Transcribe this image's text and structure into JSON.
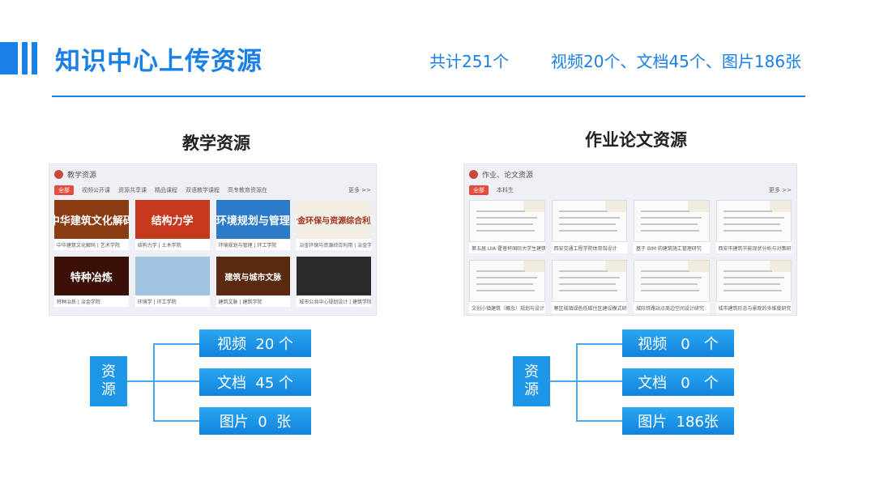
{
  "header": {
    "title": "知识中心上传资源",
    "total": "共计251个",
    "breakdown": "视频20个、文档45个、图片186张"
  },
  "teaching": {
    "title": "教学资源",
    "panel": {
      "name": "教学资源",
      "tabs": [
        "全部",
        "视频公开课",
        "资源共享课",
        "精品课程",
        "双语教学课程",
        "高专教育资源在"
      ],
      "more": "更多 >>",
      "cards": [
        {
          "thumb": "中华建筑文化解码",
          "caption": "中华建筑文化解码 | 艺术学院",
          "color": "#8a3b12"
        },
        {
          "thumb": "结构力学",
          "caption": "结构力学 | 土木学院",
          "color": "#c53a1e"
        },
        {
          "thumb": "环境规划与管理",
          "caption": "环境规划与管理 | 环工学院",
          "color": "#2c7bc9"
        },
        {
          "thumb": "冶金环保与资源综合利用",
          "caption": "冶金环保与资源综合利用 | 冶金学院",
          "color": "#f4efe3"
        },
        {
          "thumb": "特种冶炼",
          "caption": "特种冶炼 | 冶金学院",
          "color": "#3a1008"
        },
        {
          "thumb": "",
          "caption": "环境学 | 环工学院",
          "color": "#9fc3e0"
        },
        {
          "thumb": "建筑与城市文脉",
          "caption": "建筑文脉 | 建筑学院",
          "color": "#5a2a10"
        },
        {
          "thumb": "",
          "caption": "城市公共中心规划设计 | 建筑学院",
          "color": "#2a2a2a"
        }
      ]
    },
    "resource_label": [
      "资",
      "源"
    ],
    "leaves": [
      "视频  20 个",
      "文档  45 个",
      "图片  0  张"
    ]
  },
  "homework": {
    "title": "作业论文资源",
    "panel": {
      "name": "作业、论文资源",
      "tabs": [
        "全部",
        "本科生"
      ],
      "more": "更多 >>",
      "cards": [
        {
          "caption": "第五届 UIA 霍普杯国际大学生建筑设计竞赛"
        },
        {
          "caption": "西安交通工程学院体育馆设计"
        },
        {
          "caption": "基于 BIM 的建筑施工管理研究"
        },
        {
          "caption": "西安市建筑节能现状分析与对策研究"
        },
        {
          "caption": "文创小镇建筑（概念）规划与设计"
        },
        {
          "caption": "寒区城镇绿色低碳住区建设模式研究"
        },
        {
          "caption": "城际铁路站点周边空间设计研究"
        },
        {
          "caption": "城市建筑形态与景观的多维度研究"
        }
      ]
    },
    "resource_label": [
      "资",
      "源"
    ],
    "leaves": [
      "视频   0   个",
      "文档   0   个",
      "图片  186张"
    ]
  }
}
